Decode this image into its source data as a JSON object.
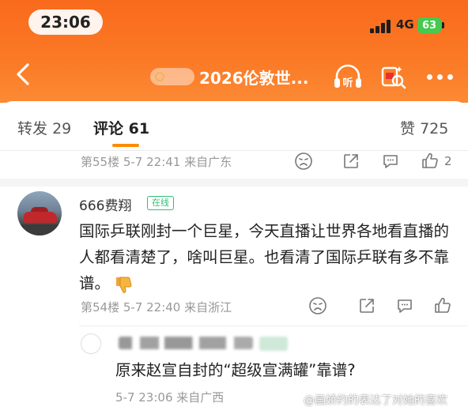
{
  "status_bar": {
    "time": "23:06",
    "network": "4G",
    "battery": "63"
  },
  "nav": {
    "back_icon": "chevron-left-icon",
    "topic_title": "2026伦敦世...",
    "listen_icon": "headphones-icon",
    "listen_label": "听",
    "save_icon": "bookmark-search-icon",
    "more_icon": "more-dots-icon"
  },
  "tabs": {
    "repost_label": "转发",
    "repost_count": "29",
    "comment_label": "评论",
    "comment_count": "61",
    "like_label": "赞",
    "like_count": "725"
  },
  "colors": {
    "header_orange": "#f96a1c",
    "accent_orange": "#ff8a00",
    "online_green": "#2fbf71"
  },
  "comments": [
    {
      "floor_meta": "第55楼  5-7 22:41  来自广东",
      "like_count": "2"
    },
    {
      "username": "666费翔",
      "badge": "在线",
      "text": "国际乒联刚封一个巨星，今天直播让世界各地看直播的人都看清楚了，啥叫巨星。也看清了国际乒联有多不靠谱。",
      "emoji": "thumbs-down-emoji",
      "floor_meta": "第54楼  5-7 22:40  来自浙江",
      "reply": {
        "text": "原来赵宣自封的“超级宣满罐”靠谱?",
        "meta": "5-7 23:06  来自广西"
      }
    }
  ],
  "watermark": "@画娇约的表达了对她的喜欢"
}
